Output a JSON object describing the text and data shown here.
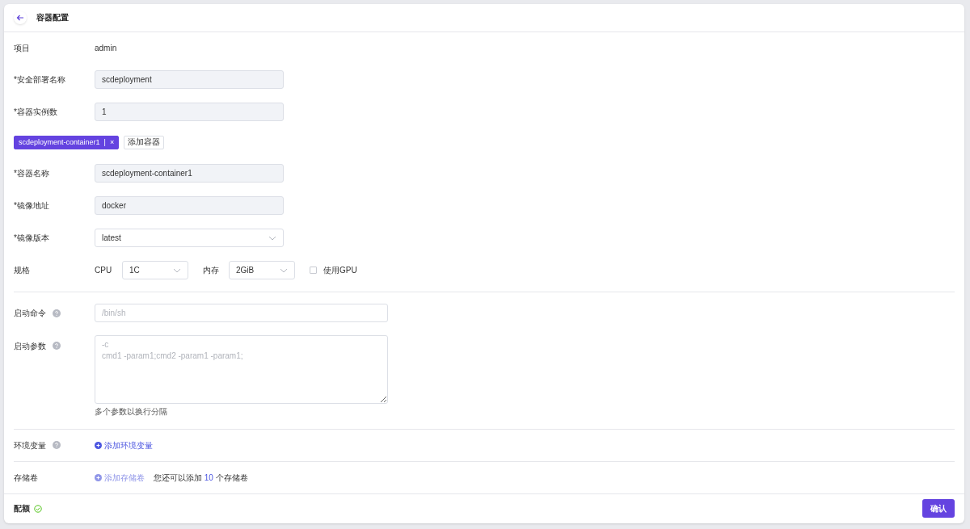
{
  "header": {
    "title": "容器配置"
  },
  "project": {
    "label": "项目",
    "value": "admin"
  },
  "fields": [
    {
      "label": "*安全部署名称",
      "value": "scdeployment"
    },
    {
      "label": "*容器实例数",
      "value": "1"
    }
  ],
  "containers": {
    "tabs": [
      {
        "label": "scdeployment-container1",
        "separator": "|",
        "close": "×",
        "selected": true
      }
    ],
    "add_button": "添加容器"
  },
  "container_fields": [
    {
      "kind": "input",
      "label": "*容器名称",
      "value": "scdeployment-container1"
    },
    {
      "kind": "input",
      "label": "*镜像地址",
      "value": "docker"
    },
    {
      "kind": "select",
      "label": "*镜像版本",
      "value": "latest"
    }
  ],
  "spec": {
    "label": "规格",
    "cpu_label": "CPU",
    "cpu": "1C",
    "memory_label": "内存",
    "memory": "2GiB",
    "gpu": {
      "label": "使用GPU",
      "checked": false
    }
  },
  "command": {
    "label": "启动命令",
    "placeholder": "/bin/sh"
  },
  "args": {
    "label": "启动参数",
    "placeholder": "-c\ncmd1 -param1;cmd2 -param1 -param1;",
    "hint": "多个参数以换行分隔"
  },
  "env": {
    "label": "环境变量",
    "action": "添加环境变量",
    "disabled": false
  },
  "volumes": {
    "label": "存储卷",
    "action": "添加存储卷",
    "disabled": true,
    "note_before": "您还可以添加",
    "count": "10",
    "note_after": "个存储卷"
  },
  "footer": {
    "quota_label": "配额",
    "quota_ok": true,
    "confirm": "确认"
  }
}
